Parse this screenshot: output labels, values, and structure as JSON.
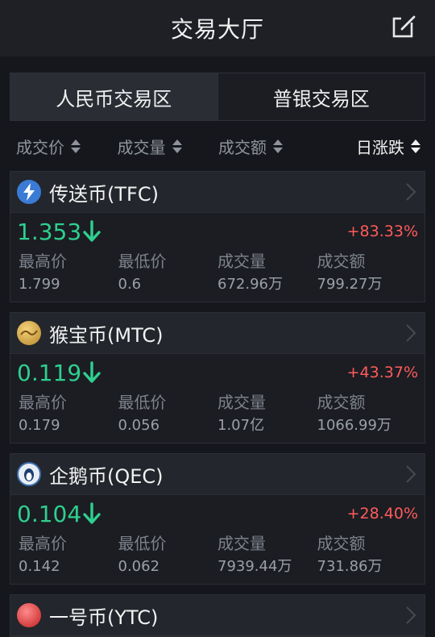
{
  "header": {
    "title": "交易大厅",
    "edit_icon": "edit-icon"
  },
  "tabs": [
    {
      "label": "人民币交易区",
      "active": true
    },
    {
      "label": "普银交易区",
      "active": false
    }
  ],
  "sort_bar": {
    "items": [
      {
        "label": "成交价"
      },
      {
        "label": "成交量"
      },
      {
        "label": "成交额"
      },
      {
        "label": "日涨跌"
      }
    ]
  },
  "stat_labels": {
    "high": "最高价",
    "low": "最低价",
    "volume": "成交量",
    "turnover": "成交额"
  },
  "colors": {
    "up": "#ff5b5b",
    "price": "#2fcf8f",
    "background": "#15171c"
  },
  "coins": [
    {
      "name": "传送币(TFC)",
      "icon": "lightning-coin-icon",
      "price": "1.353",
      "change": "+83.33%",
      "high": "1.799",
      "low": "0.6",
      "volume": "672.96万",
      "turnover": "799.27万"
    },
    {
      "name": "猴宝币(MTC)",
      "icon": "gold-coin-icon",
      "price": "0.119",
      "change": "+43.37%",
      "high": "0.179",
      "low": "0.056",
      "volume": "1.07亿",
      "turnover": "1066.99万"
    },
    {
      "name": "企鹅币(QEC)",
      "icon": "penguin-coin-icon",
      "price": "0.104",
      "change": "+28.40%",
      "high": "0.142",
      "low": "0.062",
      "volume": "7939.44万",
      "turnover": "731.86万"
    },
    {
      "name": "一号币(YTC)",
      "icon": "red-coin-icon"
    }
  ]
}
